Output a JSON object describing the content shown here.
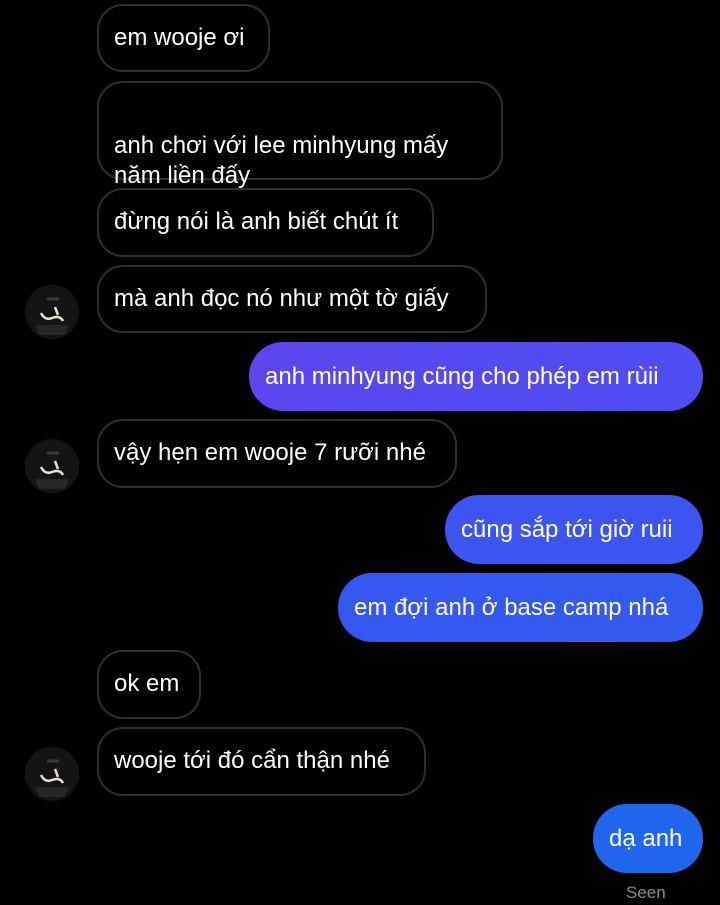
{
  "colors": {
    "background": "#000000",
    "incoming_border": "#2f2f2f",
    "outgoing_start": "#5b46f0",
    "outgoing_end": "#1f68ef",
    "text": "#ffffff",
    "seen_text": "#8a8a8a"
  },
  "messages": [
    {
      "sender": "them",
      "text": "em wooje ơi"
    },
    {
      "sender": "them",
      "text": "anh chơi với lee minhyung mấy\nnăm liền đấy"
    },
    {
      "sender": "them",
      "text": "đừng nói là anh biết chút ít"
    },
    {
      "sender": "them",
      "text": "mà anh đọc nó như một tờ giấy",
      "avatar": "contact-avatar"
    },
    {
      "sender": "me",
      "text": "anh minhyung cũng cho phép em rùii"
    },
    {
      "sender": "them",
      "text": "vậy hẹn em wooje 7 rưỡi nhé",
      "avatar": "contact-avatar"
    },
    {
      "sender": "me",
      "text": "cũng sắp tới giờ ruii"
    },
    {
      "sender": "me",
      "text": "em đợi anh ở base camp nhá"
    },
    {
      "sender": "them",
      "text": "ok em"
    },
    {
      "sender": "them",
      "text": "wooje tới đó cẩn thận nhé",
      "avatar": "contact-avatar"
    },
    {
      "sender": "me",
      "text": "dạ anh"
    }
  ],
  "status": {
    "seen": "Seen"
  }
}
